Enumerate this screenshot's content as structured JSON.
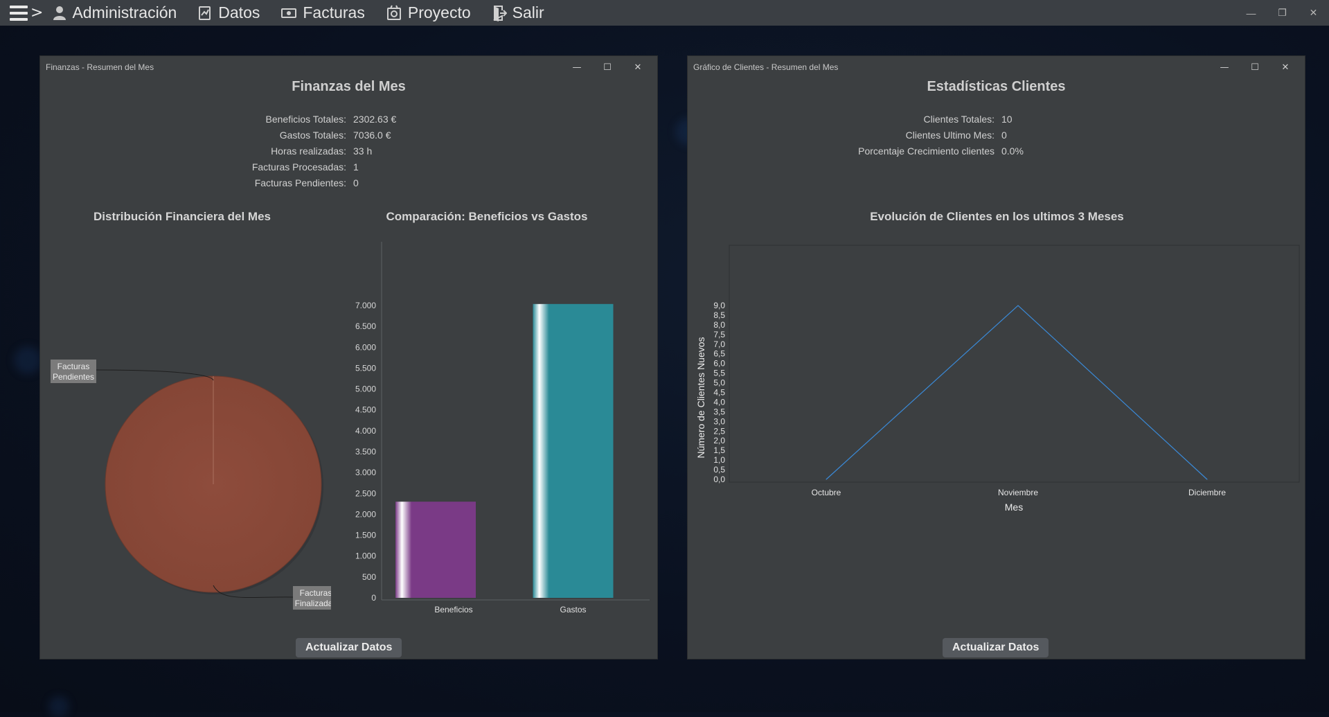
{
  "menubar": {
    "items": [
      {
        "label": "Administración",
        "icon": "user-icon"
      },
      {
        "label": "Datos",
        "icon": "data-icon"
      },
      {
        "label": "Facturas",
        "icon": "money-icon"
      },
      {
        "label": "Proyecto",
        "icon": "project-icon"
      },
      {
        "label": "Salir",
        "icon": "exit-icon"
      }
    ],
    "arrow": ">"
  },
  "finance_window": {
    "title": "Finanzas - Resumen del Mes",
    "heading": "Finanzas del Mes",
    "stats": [
      {
        "label": "Beneficios Totales:",
        "value": "2302.63 €"
      },
      {
        "label": "Gastos Totales:",
        "value": "7036.0 €"
      },
      {
        "label": "Horas realizadas:",
        "value": "33 h"
      },
      {
        "label": "Facturas Procesadas:",
        "value": "1"
      },
      {
        "label": "Facturas Pendientes:",
        "value": "0"
      }
    ],
    "refresh_label": "Actualizar Datos"
  },
  "clients_window": {
    "title": "Gráfico de Clientes - Resumen del Mes",
    "heading": "Estadísticas Clientes",
    "stats": [
      {
        "label": "Clientes Totales:",
        "value": "10"
      },
      {
        "label": "Clientes Ultimo Mes:",
        "value": "0"
      },
      {
        "label": "Porcentaje Crecimiento clientes",
        "value": "0.0%"
      }
    ],
    "refresh_label": "Actualizar Datos"
  },
  "chart_data": [
    {
      "type": "pie",
      "title": "Distribución Financiera del Mes",
      "labels": [
        "Facturas Pendientes",
        "Facturas Finalizadas"
      ],
      "values": [
        0,
        1
      ],
      "colors": [
        "#f08a2a",
        "#8a4a3a"
      ]
    },
    {
      "type": "bar",
      "title": "Comparación: Beneficios vs Gastos",
      "categories": [
        "Beneficios",
        "Gastos"
      ],
      "values": [
        2302.63,
        7036.0
      ],
      "colors": [
        "#7a3a86",
        "#2a8a96"
      ],
      "ylim": [
        0,
        7000
      ],
      "yticks": [
        "0",
        "500",
        "1.000",
        "1.500",
        "2.000",
        "2.500",
        "3.000",
        "3.500",
        "4.000",
        "4.500",
        "5.000",
        "5.500",
        "6.000",
        "6.500",
        "7.000"
      ]
    },
    {
      "type": "line",
      "title": "Evolución de Clientes en los ultimos 3 Meses",
      "xlabel": "Mes",
      "ylabel": "Número de Clientes Nuevos",
      "categories": [
        "Octubre",
        "Noviembre",
        "Diciembre"
      ],
      "values": [
        0,
        9,
        0
      ],
      "color": "#3a8ad8",
      "ylim": [
        0,
        9
      ],
      "yticks": [
        "0,0",
        "0,5",
        "1,0",
        "1,5",
        "2,0",
        "2,5",
        "3,0",
        "3,5",
        "4,0",
        "4,5",
        "5,0",
        "5,5",
        "6,0",
        "6,5",
        "7,0",
        "7,5",
        "8,0",
        "8,5",
        "9,0"
      ]
    }
  ]
}
